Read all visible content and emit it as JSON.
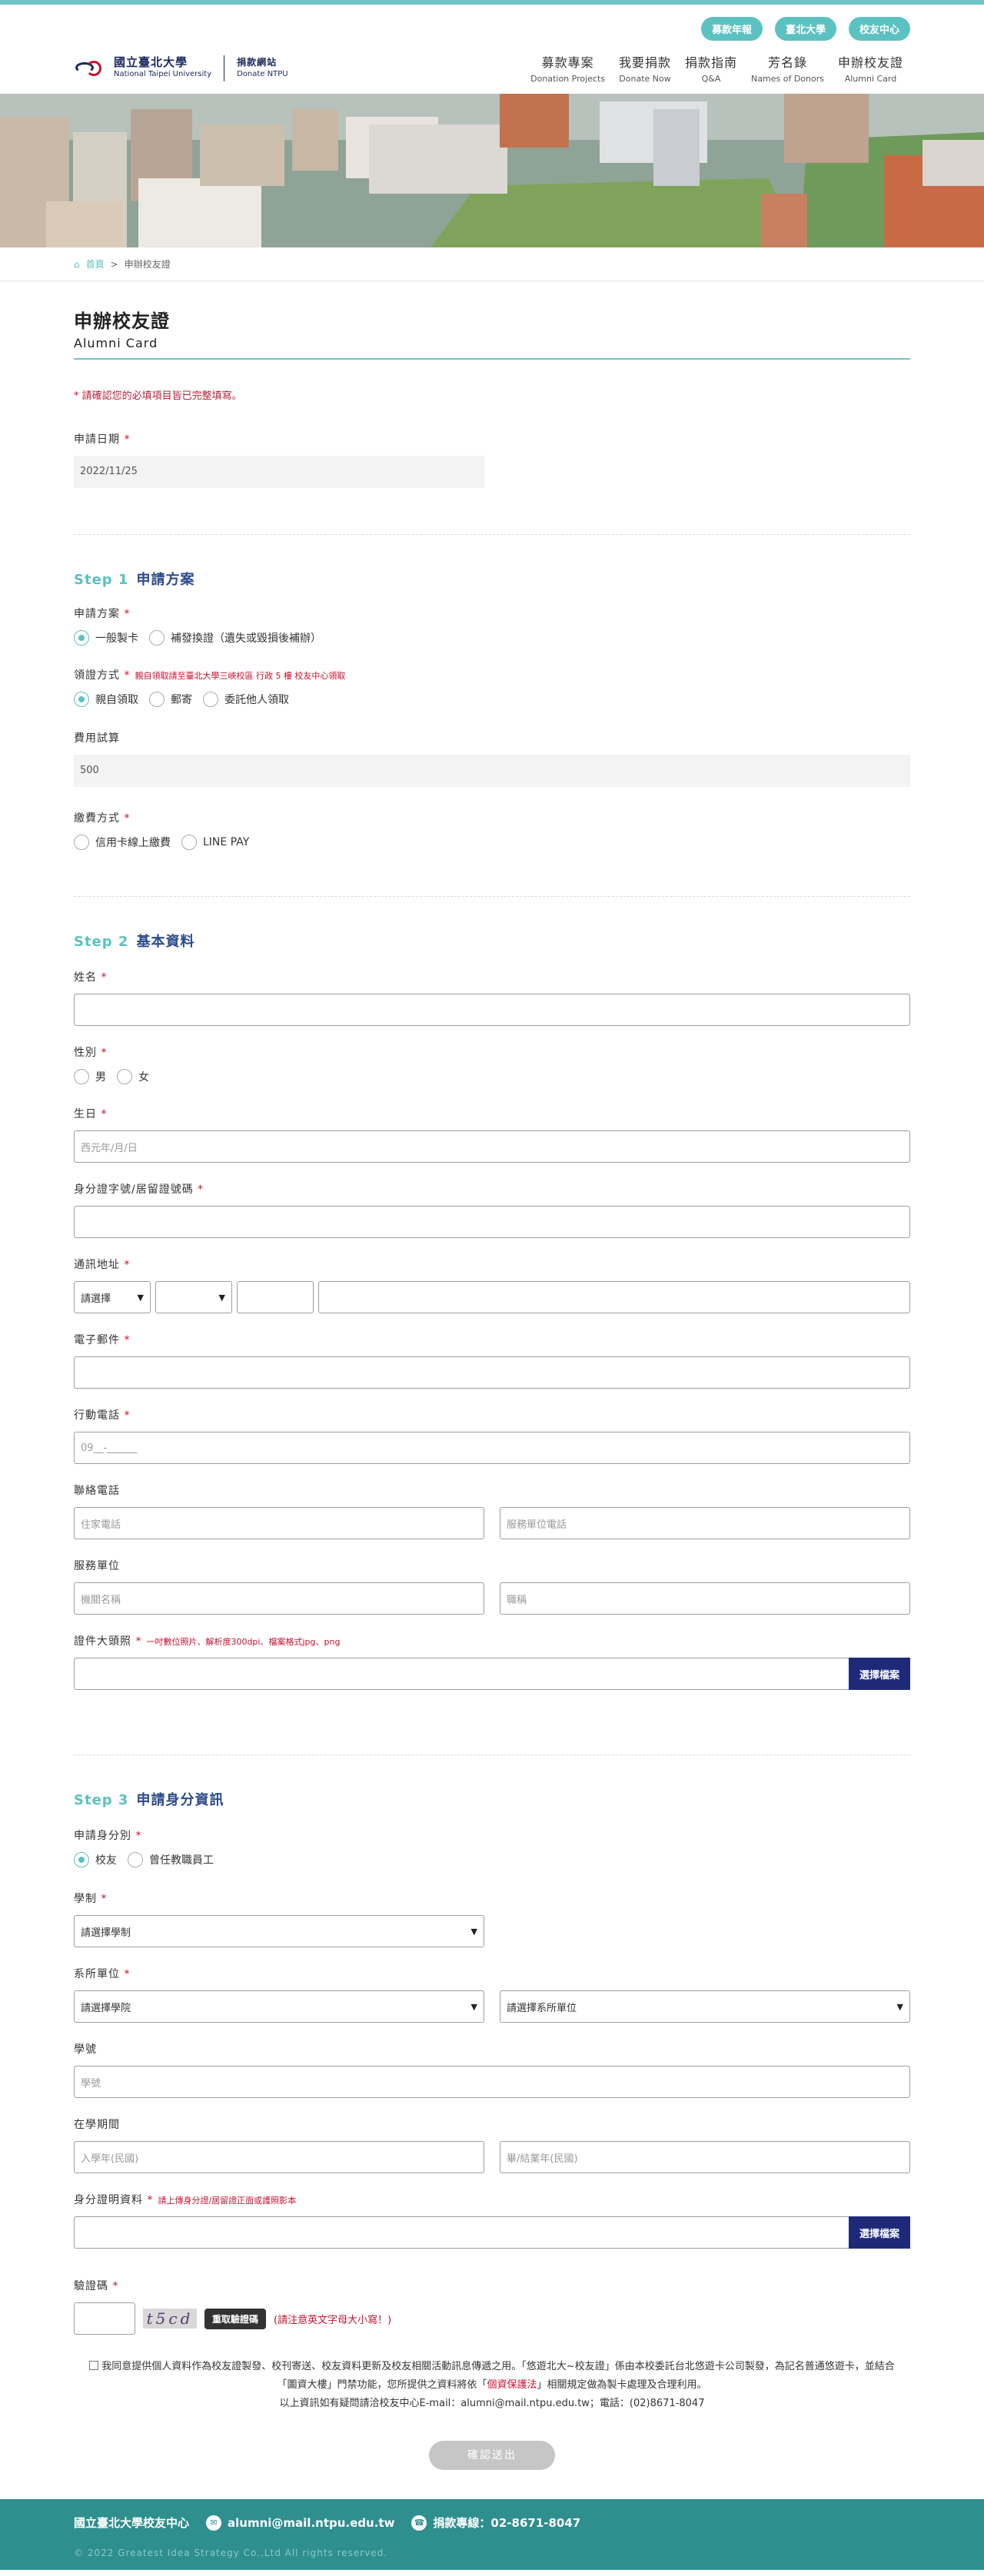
{
  "header": {
    "logo_cn": "國立臺北大學",
    "logo_en": "National Taipei University",
    "logo_sub_cn": "捐款網站",
    "logo_sub_en": "Donate NTPU",
    "pills": [
      "募款年報",
      "臺北大學",
      "校友中心"
    ],
    "nav": [
      {
        "cn": "募款專案",
        "en": "Donation Projects"
      },
      {
        "cn": "我要捐款",
        "en": "Donate Now"
      },
      {
        "cn": "捐款指南",
        "en": "Q&A"
      },
      {
        "cn": "芳名錄",
        "en": "Names of Donors"
      },
      {
        "cn": "申辦校友證",
        "en": "Alumni Card"
      }
    ]
  },
  "breadcrumb": {
    "home": "首頁",
    "sep": ">",
    "current": "申辦校友證"
  },
  "page": {
    "title": "申辦校友證",
    "title_en": "Alumni Card",
    "required_note": "請確認您的必填項目皆已完整填寫。"
  },
  "apply_date": {
    "label": "申請日期",
    "value": "2022/11/25"
  },
  "step1": {
    "num": "Step 1",
    "title": "申請方案",
    "plan": {
      "label": "申請方案",
      "options": [
        "一般製卡",
        "補發換證（遺失或毀損後補辦）"
      ],
      "selected": 0
    },
    "pickup": {
      "label": "領證方式",
      "hint": "親自領取請至臺北大學三峽校區 行政 5 樓 校友中心領取",
      "options": [
        "親自領取",
        "郵寄",
        "委託他人領取"
      ],
      "selected": 0
    },
    "fee": {
      "label": "費用試算",
      "value": "500"
    },
    "payment": {
      "label": "繳費方式",
      "options": [
        "信用卡線上繳費",
        "LINE PAY"
      ]
    }
  },
  "step2": {
    "num": "Step 2",
    "title": "基本資料",
    "name": {
      "label": "姓名"
    },
    "gender": {
      "label": "性別",
      "options": [
        "男",
        "女"
      ]
    },
    "birthday": {
      "label": "生日",
      "placeholder": "西元年/月/日"
    },
    "id_no": {
      "label": "身分證字號/居留證號碼"
    },
    "address": {
      "label": "通訊地址",
      "county": "請選擇"
    },
    "email": {
      "label": "電子郵件"
    },
    "mobile": {
      "label": "行動電話",
      "placeholder": "09__-______"
    },
    "phone": {
      "label": "聯絡電話",
      "home": "住家電話",
      "work": "服務單位電話"
    },
    "employer": {
      "label": "服務單位",
      "org": "機關名稱",
      "title": "職稱"
    },
    "photo": {
      "label": "證件大頭照",
      "hint": "一吋數位照片、解析度300dpi、檔案格式jpg、png",
      "button": "選擇檔案"
    }
  },
  "step3": {
    "num": "Step 3",
    "title": "申請身分資訊",
    "identity": {
      "label": "申請身分別",
      "options": [
        "校友",
        "曾任教職員工"
      ],
      "selected": 0
    },
    "system": {
      "label": "學制",
      "value": "請選擇學制"
    },
    "dept": {
      "label": "系所單位",
      "college": "請選擇學院",
      "unit": "請選擇系所單位"
    },
    "student_no": {
      "label": "學號",
      "placeholder": "學號"
    },
    "period": {
      "label": "在學期間",
      "start": "入學年(民國)",
      "end": "畢/結業年(民國)"
    },
    "proof": {
      "label": "身分證明資料",
      "hint": "請上傳身分證/居留證正面或護照影本",
      "button": "選擇檔案"
    }
  },
  "captcha": {
    "label": "驗證碼",
    "code": "t5cd",
    "button": "重取驗證碼",
    "note": "(請注意英文字母大小寫！)"
  },
  "agreement": {
    "part1": "我同意提供個人資料作為校友證製發、校刊寄送、校友資料更新及校友相關活動訊息傳遞之用。「悠遊北大~校友證」係由本校委託台北悠遊卡公司製發，為記名普通悠遊卡，並結合「圖資大樓」門禁功能，您所提供之資料將依「",
    "link": "個資保護法",
    "part2": "」相關規定做為製卡處理及合理利用。",
    "contact": "以上資訊如有疑問請洽校友中心E-mail：alumni@mail.ntpu.edu.tw；電話：(02)8671-8047"
  },
  "submit_label": "確認送出",
  "footer": {
    "org": "國立臺北大學校友中心",
    "email": "alumni@mail.ntpu.edu.tw",
    "phone": "捐款專線：02-8671-8047",
    "copyright": "© 2022 Greatest Idea Strategy Co.,Ltd All rights reserved."
  }
}
